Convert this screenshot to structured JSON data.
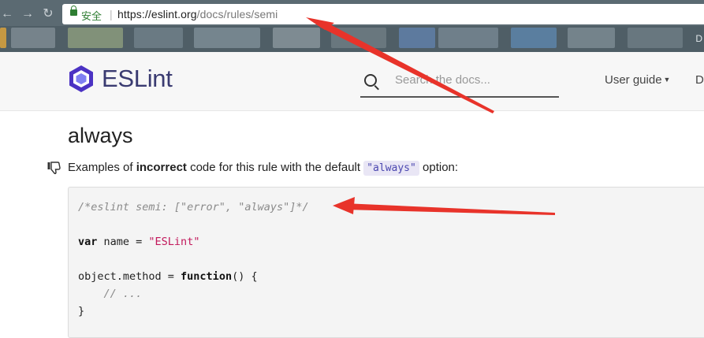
{
  "browser": {
    "secure_label": "安全",
    "url_host": "https://eslint.org",
    "url_path": "/docs/rules/semi",
    "bookmarks_overflow": "D"
  },
  "site": {
    "logo_text": "ESLint",
    "brand_color": "#4b32c3",
    "search": {
      "placeholder": "Search the docs..."
    },
    "nav": {
      "user_guide": "User guide",
      "next_item": "D"
    }
  },
  "content": {
    "heading": "always",
    "desc_prefix": "Examples of ",
    "desc_bold": "incorrect",
    "desc_mid": " code for this rule with the default ",
    "desc_code": "\"always\"",
    "desc_suffix": " option:",
    "code": {
      "comment": "/*eslint semi: [\"error\", \"always\"]*/",
      "line2_kw": "var",
      "line2_text": " name = ",
      "line2_str": "\"ESLint\"",
      "line3_text": "object.method = ",
      "line3_kw": "function",
      "line3_rest": "() {",
      "line4": "    // ...",
      "line5": "}"
    }
  },
  "annotations": {
    "arrow_color": "#e8332a"
  }
}
